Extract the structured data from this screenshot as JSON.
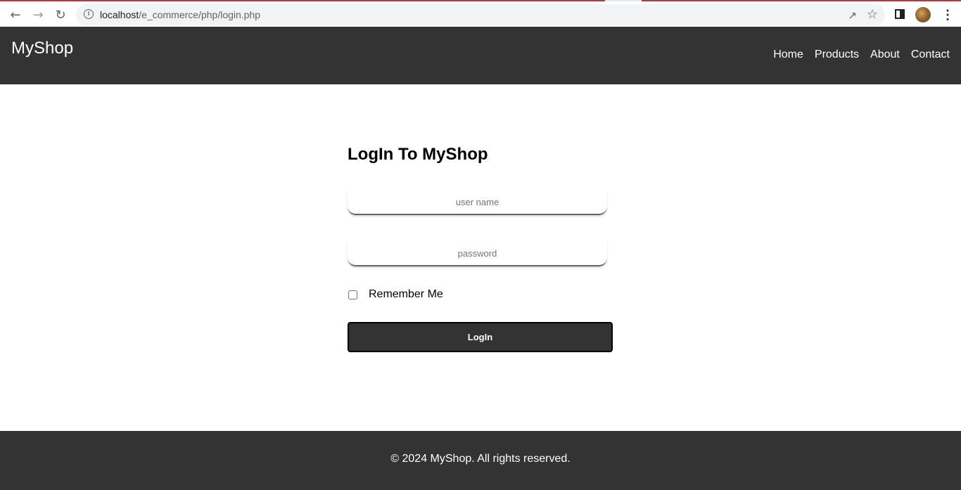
{
  "browser": {
    "url_host": "localhost",
    "url_path": "/e_commerce/php/login.php",
    "back_icon": "arrow-left-icon",
    "forward_icon": "arrow-right-icon",
    "reload_icon": "reload-icon",
    "info_icon": "info-icon",
    "share_icon": "share-icon",
    "bookmark_icon": "star-icon",
    "sidepanel_icon": "side-panel-icon",
    "menu_icon": "kebab-menu-icon"
  },
  "header": {
    "brand": "MyShop",
    "nav": [
      "Home",
      "Products",
      "About",
      "Contact"
    ]
  },
  "login": {
    "title": "LogIn To MyShop",
    "username_placeholder": "user name",
    "password_placeholder": "password",
    "remember_label": "Remember Me",
    "remember_checked": false,
    "button_label": "LogIn"
  },
  "footer": {
    "text": "© 2024 MyShop. All rights reserved."
  },
  "colors": {
    "header_bg": "#333333",
    "button_bg": "#333333",
    "footer_bg": "#333333"
  }
}
